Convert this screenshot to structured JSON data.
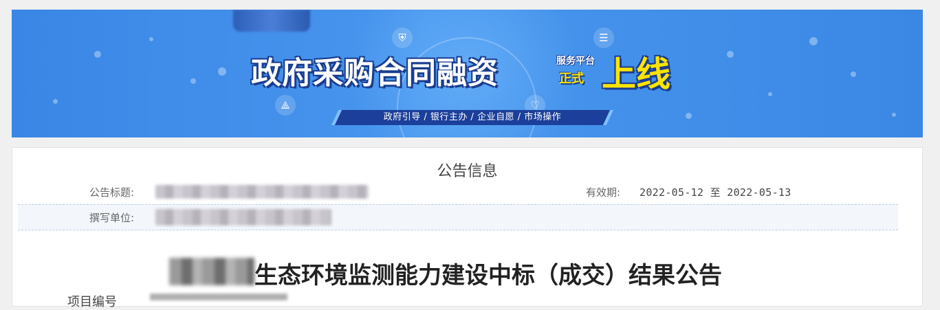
{
  "banner": {
    "title": "政府采购合同融资",
    "service_tag": "服务平台",
    "official": "正式",
    "launch": "上线",
    "ribbon": "政府引导 / 银行主办 / 企业自愿 / 市场操作",
    "colors": {
      "background": "#3a88e4",
      "outline": "#1a3d8f",
      "accent": "#ffe400"
    }
  },
  "notice": {
    "section_title": "公告信息",
    "title_label": "公告标题:",
    "title_value": "",
    "validity_label": "有效期:",
    "validity_value": "2022-05-12 至 2022-05-13",
    "author_label": "撰写单位:",
    "author_value": ""
  },
  "document": {
    "heading": "生态环境监测能力建设中标（成交）结果公告",
    "next_line_partial": "项目编号"
  },
  "icons": [
    "shield-icon",
    "list-icon",
    "heart-icon",
    "network-icon"
  ]
}
